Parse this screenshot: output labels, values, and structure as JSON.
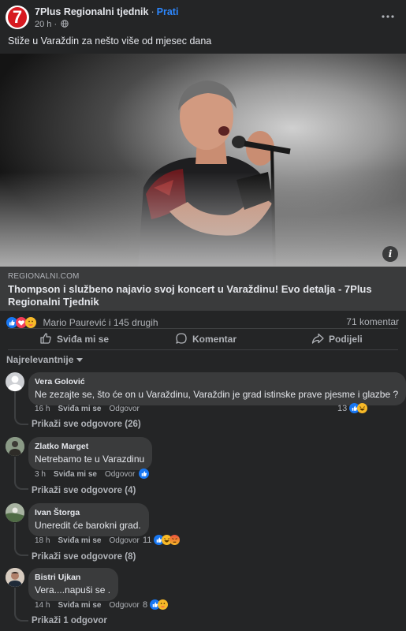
{
  "post": {
    "page_name": "7Plus Regionalni tjednik",
    "separator": "·",
    "follow_label": "Prati",
    "time": "20 h",
    "meta_dot": "·",
    "text": "Stiže u Varaždin za nešto više od mjesec dana",
    "logo_text": "7"
  },
  "link": {
    "domain": "REGIONALNI.COM",
    "title": "Thompson i službeno najavio svoj koncert u Varaždinu! Evo detalja - 7Plus Regionalni Tjednik"
  },
  "reactions": {
    "names": "Mario Paurević i 145 drugih",
    "comments_count": "71 komentar",
    "types": [
      "like",
      "love",
      "care"
    ]
  },
  "actions": {
    "like": "Sviđa mi se",
    "comment": "Komentar",
    "share": "Podijeli"
  },
  "sort_label": "Najrelevantnije",
  "comments": [
    {
      "name": "Vera Golović",
      "text": "Ne zezajte se, što će on u Varaždinu, Varaždin je grad istinske prave pjesme i glazbe ?",
      "time": "16 h",
      "like": "Sviđa mi se",
      "reply": "Odgovor",
      "react_count": "13",
      "replies": "Prikaži sve odgovore (26)"
    },
    {
      "name": "Zlatko Marget",
      "text": "Netrebamo te u Varazdinu",
      "time": "3 h",
      "like": "Sviđa mi se",
      "reply": "Odgovor",
      "react_count": "",
      "replies": "Prikaži sve odgovore (4)"
    },
    {
      "name": "Ivan Štorga",
      "text": "Uneredit će barokni grad.",
      "time": "18 h",
      "like": "Sviđa mi se",
      "reply": "Odgovor",
      "react_count": "11",
      "replies": "Prikaži sve odgovore (8)"
    },
    {
      "name": "Bistri Ujkan",
      "text": "Vera....napuši se .",
      "time": "14 h",
      "like": "Sviđa mi se",
      "reply": "Odgovor",
      "react_count": "8",
      "replies": "Prikaži 1 odgovor"
    }
  ],
  "icons": {
    "globe": "globe-icon",
    "more": "more-icon",
    "info": "info-icon",
    "like": "thumbs-up-icon",
    "comment": "comment-icon",
    "share": "share-icon",
    "sort": "chevron-down-icon"
  },
  "colors": {
    "accent": "#2d88ff",
    "brand_red": "#d71920",
    "like_blue": "#1877f2",
    "love_red": "#f33e58",
    "haha_yellow": "#f7b928"
  },
  "info_glyph": "i"
}
